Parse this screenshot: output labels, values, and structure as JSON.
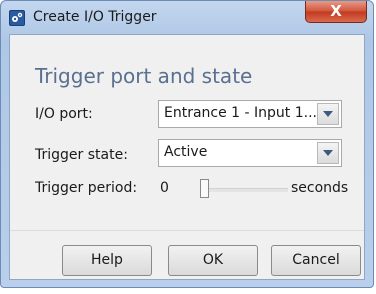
{
  "window": {
    "title": "Create I/O Trigger",
    "close_glyph": "X",
    "icon": "gears-icon"
  },
  "form": {
    "heading": "Trigger port and state",
    "io_port": {
      "label": "I/O port:",
      "value": "Entrance 1 - Input 1..."
    },
    "trigger_state": {
      "label": "Trigger state:",
      "value": "Active"
    },
    "trigger_period": {
      "label": "Trigger period:",
      "value": "0",
      "unit": "seconds",
      "slider_level": 0
    }
  },
  "buttons": {
    "help": "Help",
    "ok": "OK",
    "cancel": "Cancel"
  }
}
